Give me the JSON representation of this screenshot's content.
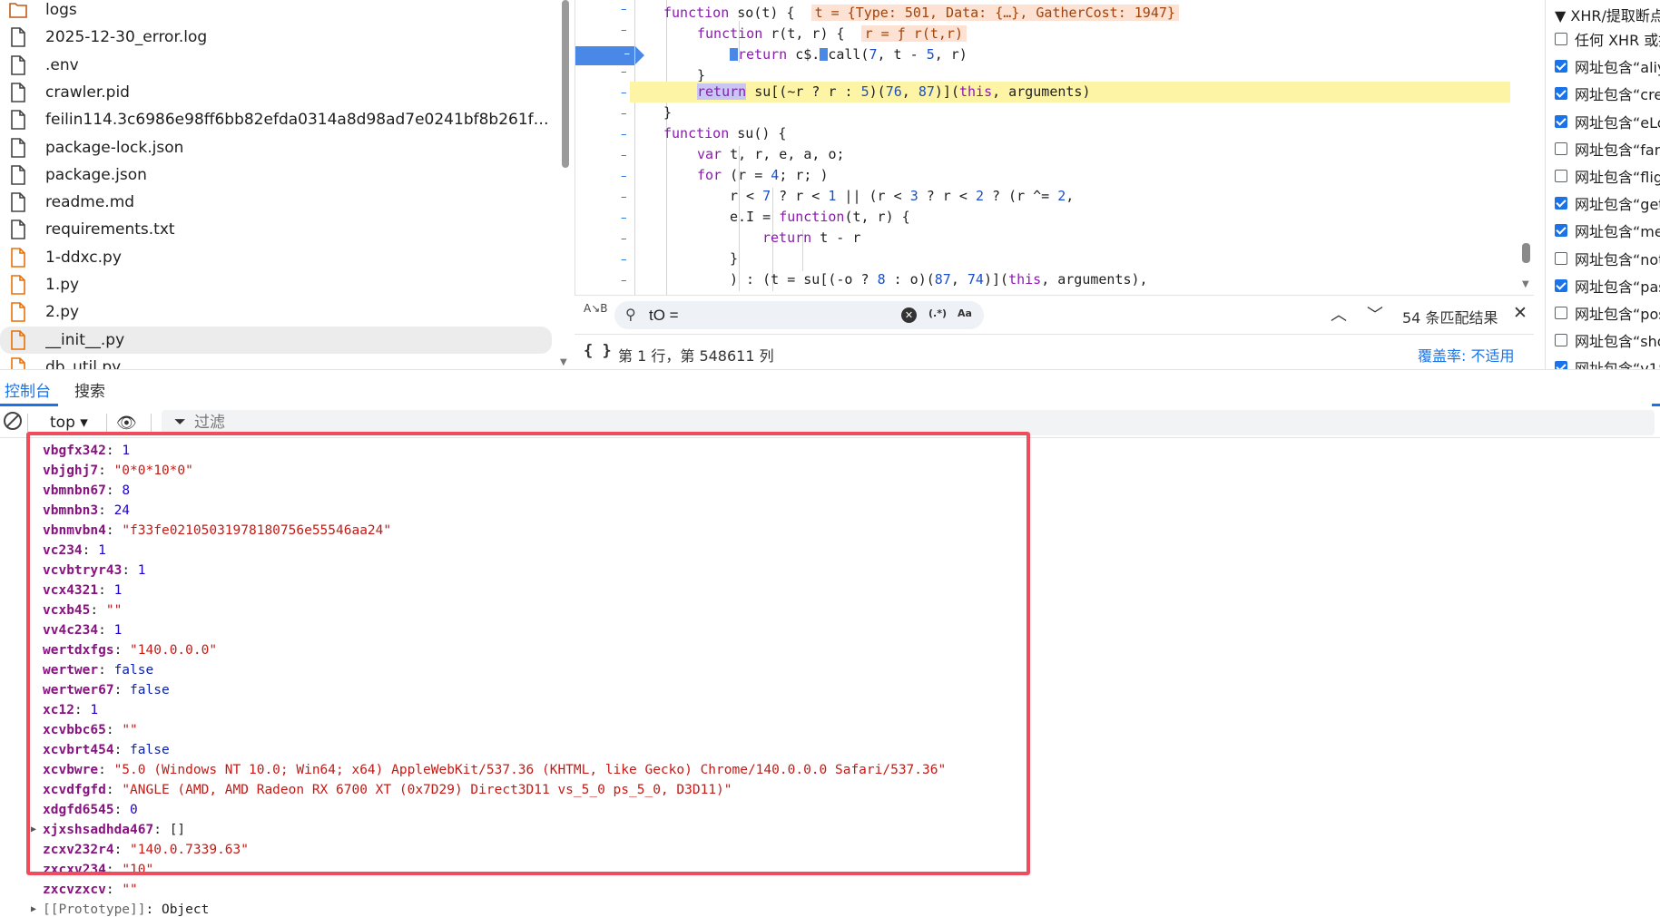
{
  "file_tree": {
    "items": [
      {
        "name": "logs",
        "type": "folder"
      },
      {
        "name": "2025-12-30_error.log",
        "type": "file"
      },
      {
        "name": ".env",
        "type": "file"
      },
      {
        "name": "crawler.pid",
        "type": "file"
      },
      {
        "name": "feilin114.3c6986e98ff6bb82efda0314a8d98ad7e0241bf8b261f3ea12f...",
        "type": "file"
      },
      {
        "name": "package-lock.json",
        "type": "file"
      },
      {
        "name": "package.json",
        "type": "file"
      },
      {
        "name": "readme.md",
        "type": "file"
      },
      {
        "name": "requirements.txt",
        "type": "file"
      },
      {
        "name": "1-ddxc.py",
        "type": "py"
      },
      {
        "name": "1.py",
        "type": "py"
      },
      {
        "name": "2.py",
        "type": "py"
      },
      {
        "name": "__init__.py",
        "type": "py",
        "selected": true
      },
      {
        "name": "db_util.py",
        "type": "py"
      }
    ]
  },
  "editor": {
    "inline_values": {
      "so": "t = {Type: 501, Data: {…}, GatherCost: 1947}",
      "r": "r = ƒ r(t,r)"
    },
    "lines": [
      [
        "so_decl"
      ],
      [
        "r_decl"
      ],
      [
        "return_call"
      ],
      [
        "close1"
      ],
      [
        "return_su"
      ],
      [
        "close2"
      ],
      [
        "su_decl"
      ],
      [
        "var_decl"
      ],
      [
        "for_loop"
      ],
      [
        "cond"
      ],
      [
        "assign"
      ],
      [
        "return_tr"
      ],
      [
        "close3"
      ],
      [
        "tail"
      ]
    ]
  },
  "search": {
    "query": "tO =",
    "regex_label": "(.*)",
    "case_label": "Aa",
    "result_count": "54 条匹配结果",
    "ab_label": "A↘B"
  },
  "footer": {
    "braces": "{ }",
    "position": "第 1 行，第 548611 列",
    "coverage": "覆盖率: 不适用"
  },
  "xhr_panel": {
    "header": "▼ XHR/提取断点",
    "items": [
      {
        "label": "任何 XHR 或提取",
        "checked": false
      },
      {
        "label": "网址包含“aliyun”",
        "checked": true
      },
      {
        "label": "网址包含“create”",
        "checked": true
      },
      {
        "label": "网址包含“eLog”",
        "checked": true
      },
      {
        "label": "网址包含“fanyi”",
        "checked": false
      },
      {
        "label": "网址包含“flight”",
        "checked": false
      },
      {
        "label": "网址包含“get”",
        "checked": true
      },
      {
        "label": "网址包含“me”",
        "checked": true
      },
      {
        "label": "网址包含“notify”",
        "checked": false
      },
      {
        "label": "网址包含“pass”",
        "checked": true
      },
      {
        "label": "网址包含“post”",
        "checked": false
      },
      {
        "label": "网址包含“show”",
        "checked": false
      },
      {
        "label": "网址包含“v1”",
        "checked": true
      }
    ]
  },
  "drawer": {
    "tabs": [
      {
        "label": "控制台",
        "active": true
      },
      {
        "label": "搜索",
        "active": false
      }
    ]
  },
  "console_toolbar": {
    "context": "top ▾",
    "filter_placeholder": "过滤"
  },
  "console": {
    "props": [
      {
        "key": "vbgfx342",
        "value": "1",
        "type": "num"
      },
      {
        "key": "vbjghj7",
        "value": "\"0*0*10*0\"",
        "type": "str"
      },
      {
        "key": "vbmnbn67",
        "value": "8",
        "type": "num"
      },
      {
        "key": "vbmnbn3",
        "value": "24",
        "type": "num"
      },
      {
        "key": "vbnmvbn4",
        "value": "\"f33fe02105031978180756e55546aa24\"",
        "type": "str"
      },
      {
        "key": "vc234",
        "value": "1",
        "type": "num"
      },
      {
        "key": "vcvbtryr43",
        "value": "1",
        "type": "num"
      },
      {
        "key": "vcx4321",
        "value": "1",
        "type": "num"
      },
      {
        "key": "vcxb45",
        "value": "\"\"",
        "type": "str"
      },
      {
        "key": "vv4c234",
        "value": "1",
        "type": "num"
      },
      {
        "key": "wertdxfgs",
        "value": "\"140.0.0.0\"",
        "type": "str"
      },
      {
        "key": "wertwer",
        "value": "false",
        "type": "bool"
      },
      {
        "key": "wertwer67",
        "value": "false",
        "type": "bool"
      },
      {
        "key": "xc12",
        "value": "1",
        "type": "num"
      },
      {
        "key": "xcvbbc65",
        "value": "\"\"",
        "type": "str"
      },
      {
        "key": "xcvbrt454",
        "value": "false",
        "type": "bool"
      },
      {
        "key": "xcvbwre",
        "value": "\"5.0 (Windows NT 10.0; Win64; x64) AppleWebKit/537.36 (KHTML, like Gecko) Chrome/140.0.0.0 Safari/537.36\"",
        "type": "str"
      },
      {
        "key": "xcvdfgfd",
        "value": "\"ANGLE (AMD, AMD Radeon RX 6700 XT (0x7D29) Direct3D11 vs_5_0 ps_5_0, D3D11)\"",
        "type": "str"
      },
      {
        "key": "xdgfd6545",
        "value": "0",
        "type": "num"
      },
      {
        "key": "xjxshsadhda467",
        "value": "[]",
        "type": "obj",
        "expandable": true
      },
      {
        "key": "zcxv232r4",
        "value": "\"140.0.7339.63\"",
        "type": "str"
      },
      {
        "key": "zxcxv234",
        "value": "\"10\"",
        "type": "str"
      },
      {
        "key": "zxcvzxcv",
        "value": "\"\"",
        "type": "str"
      },
      {
        "key": "[[Prototype]]",
        "value": "Object",
        "type": "obj",
        "expandable": true,
        "proto": true
      }
    ]
  },
  "colors": {
    "accent": "#1a73e8",
    "highlight_line": "#fdf4a5",
    "annotation_frame": "#ef4d5e",
    "inline_value_bg": "#fde1d3"
  }
}
